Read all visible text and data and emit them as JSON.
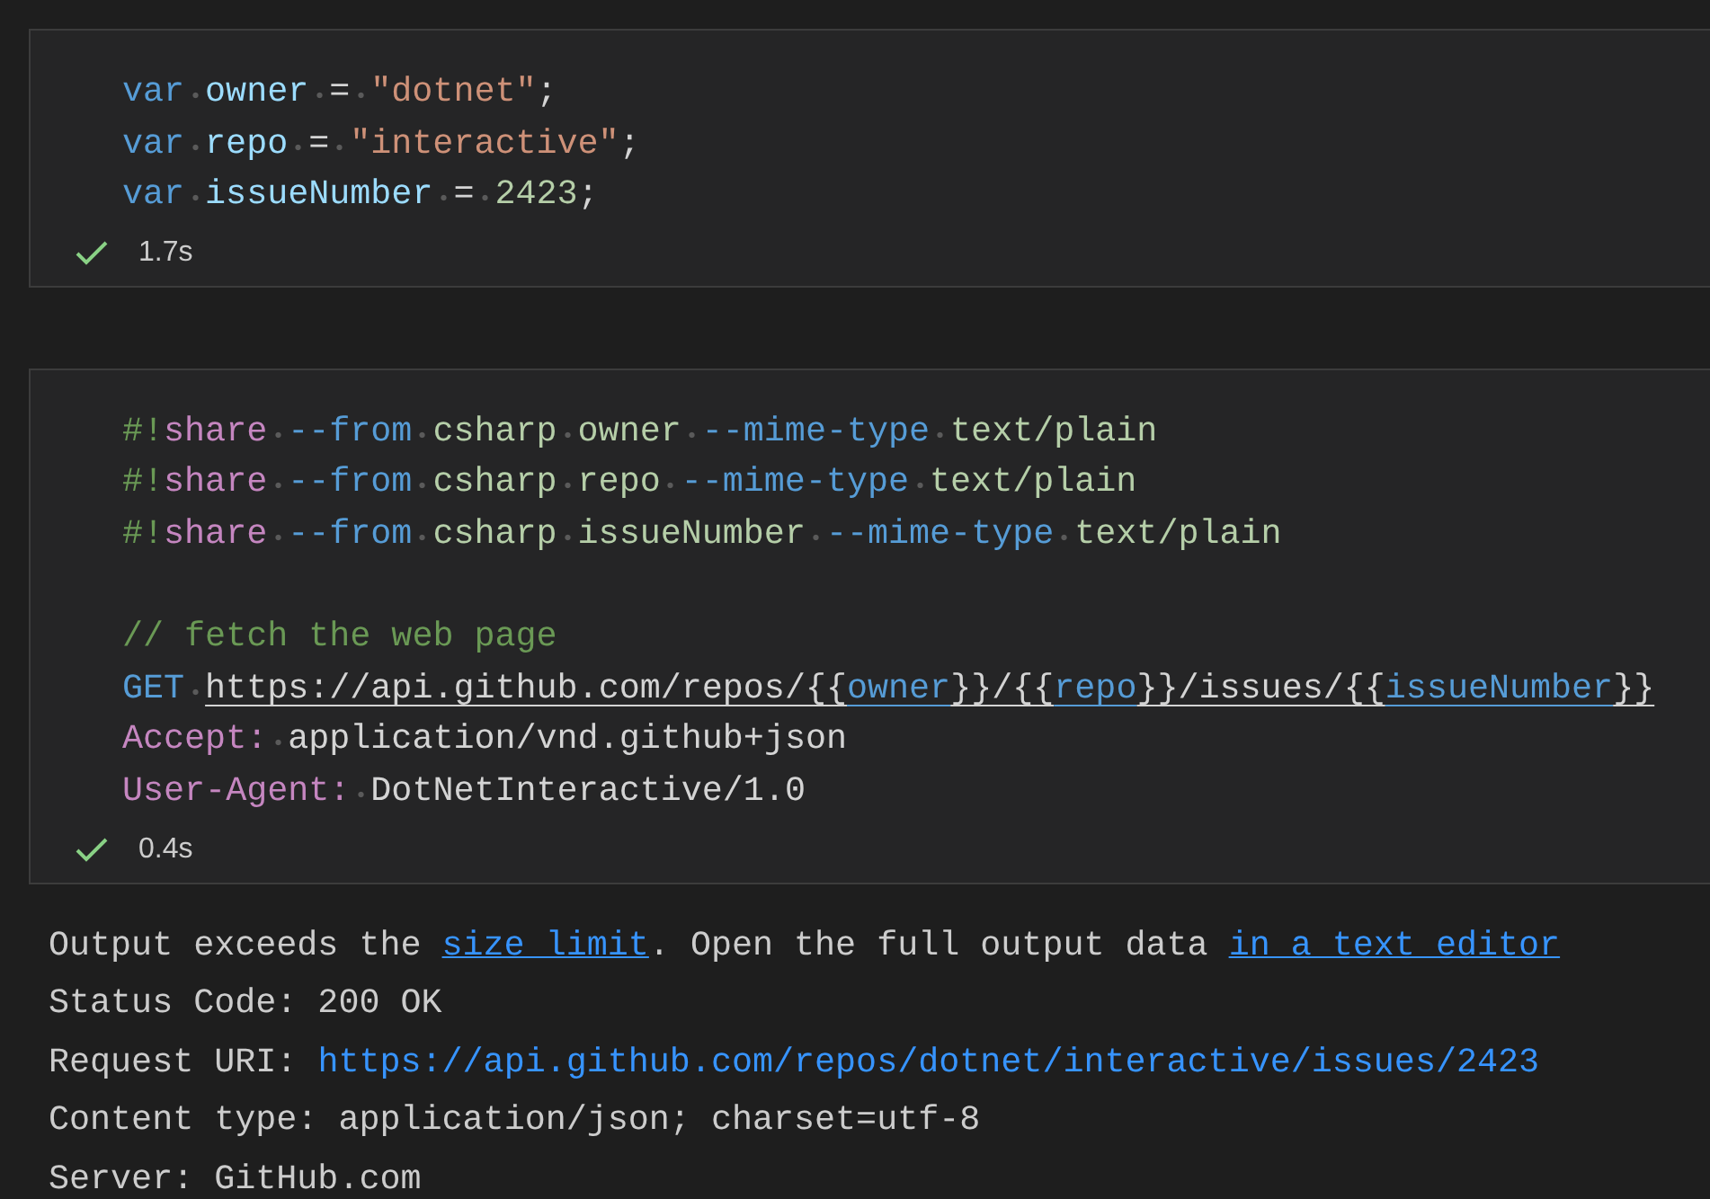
{
  "cells": [
    {
      "lines": [
        {
          "kind": "code",
          "tokens": [
            {
              "text": "var",
              "kind": "keyword"
            },
            {
              "text": "owner",
              "kind": "variable",
              "gap_before": true
            },
            {
              "text": "=",
              "kind": "plain",
              "gap_before": true
            },
            {
              "text": "\"dotnet\"",
              "kind": "string",
              "gap_before": true
            },
            {
              "text": ";",
              "kind": "plain"
            }
          ]
        },
        {
          "kind": "code",
          "tokens": [
            {
              "text": "var",
              "kind": "keyword"
            },
            {
              "text": "repo",
              "kind": "variable",
              "gap_before": true
            },
            {
              "text": "=",
              "kind": "plain",
              "gap_before": true
            },
            {
              "text": "\"interactive\"",
              "kind": "string",
              "gap_before": true
            },
            {
              "text": ";",
              "kind": "plain"
            }
          ]
        },
        {
          "kind": "code",
          "tokens": [
            {
              "text": "var",
              "kind": "keyword"
            },
            {
              "text": "issueNumber",
              "kind": "variable",
              "gap_before": true
            },
            {
              "text": "=",
              "kind": "plain",
              "gap_before": true
            },
            {
              "text": "2423",
              "kind": "number",
              "gap_before": true
            },
            {
              "text": ";",
              "kind": "plain"
            }
          ]
        }
      ],
      "status": {
        "succeeded": true,
        "time": "1.7s"
      }
    },
    {
      "lines": [
        {
          "kind": "code",
          "tokens": [
            {
              "text": "#!",
              "kind": "comment"
            },
            {
              "text": "share",
              "kind": "magic"
            },
            {
              "text": "--from",
              "kind": "keyword",
              "gap_before": true
            },
            {
              "text": "csharp",
              "kind": "argument",
              "gap_before": true
            },
            {
              "text": "owner",
              "kind": "argument",
              "gap_before": true
            },
            {
              "text": "--mime-type",
              "kind": "keyword",
              "gap_before": true
            },
            {
              "text": "text/plain",
              "kind": "argument",
              "gap_before": true
            }
          ]
        },
        {
          "kind": "code",
          "tokens": [
            {
              "text": "#!",
              "kind": "comment"
            },
            {
              "text": "share",
              "kind": "magic"
            },
            {
              "text": "--from",
              "kind": "keyword",
              "gap_before": true
            },
            {
              "text": "csharp",
              "kind": "argument",
              "gap_before": true
            },
            {
              "text": "repo",
              "kind": "argument",
              "gap_before": true
            },
            {
              "text": "--mime-type",
              "kind": "keyword",
              "gap_before": true
            },
            {
              "text": "text/plain",
              "kind": "argument",
              "gap_before": true
            }
          ]
        },
        {
          "kind": "code",
          "tokens": [
            {
              "text": "#!",
              "kind": "comment"
            },
            {
              "text": "share",
              "kind": "magic"
            },
            {
              "text": "--from",
              "kind": "keyword",
              "gap_before": true
            },
            {
              "text": "csharp",
              "kind": "argument",
              "gap_before": true
            },
            {
              "text": "issueNumber",
              "kind": "argument",
              "gap_before": true
            },
            {
              "text": "--mime-type",
              "kind": "keyword",
              "gap_before": true
            },
            {
              "text": "text/plain",
              "kind": "argument",
              "gap_before": true
            }
          ]
        },
        {
          "kind": "blank"
        },
        {
          "kind": "code",
          "tokens": [
            {
              "text": "// fetch the web page",
              "kind": "comment"
            }
          ]
        },
        {
          "kind": "code",
          "tokens": [
            {
              "text": "GET",
              "kind": "keyword"
            },
            {
              "text": "https://api.github.com/repos/{{",
              "kind": "url",
              "gap_before": true
            },
            {
              "text": "owner",
              "kind": "url_var"
            },
            {
              "text": "}}/{{",
              "kind": "url"
            },
            {
              "text": "repo",
              "kind": "url_var"
            },
            {
              "text": "}}/issues/{{",
              "kind": "url"
            },
            {
              "text": "issueNumber",
              "kind": "url_var"
            },
            {
              "text": "}}",
              "kind": "url"
            }
          ]
        },
        {
          "kind": "code",
          "tokens": [
            {
              "text": "Accept:",
              "kind": "magic"
            },
            {
              "text": "application/vnd.github+json",
              "kind": "plain",
              "gap_before": true
            }
          ]
        },
        {
          "kind": "code",
          "tokens": [
            {
              "text": "User-Agent:",
              "kind": "magic"
            },
            {
              "text": "DotNetInteractive/1.0",
              "kind": "plain",
              "gap_before": true
            }
          ]
        }
      ],
      "status": {
        "succeeded": true,
        "time": "0.4s"
      }
    }
  ],
  "output": [
    {
      "parts": [
        {
          "text": "Output exceeds the",
          "kind": "text"
        },
        {
          "text": "size limit",
          "kind": "link",
          "gap_before": true
        },
        {
          "text": ". Open the full output data",
          "kind": "text"
        },
        {
          "text": "in a text editor",
          "kind": "link",
          "gap_before": true
        }
      ]
    },
    {
      "parts": [
        {
          "text": "Status Code: 200 OK",
          "kind": "text"
        }
      ]
    },
    {
      "parts": [
        {
          "text": "Request URI:",
          "kind": "text"
        },
        {
          "text": "https://api.github.com/repos/dotnet/interactive/issues/2423",
          "kind": "url",
          "gap_before": true
        }
      ]
    },
    {
      "parts": [
        {
          "text": "Content type: application/json; charset=utf-8",
          "kind": "text"
        }
      ]
    },
    {
      "parts": [
        {
          "text": "Server: GitHub.com",
          "kind": "text"
        }
      ]
    }
  ]
}
